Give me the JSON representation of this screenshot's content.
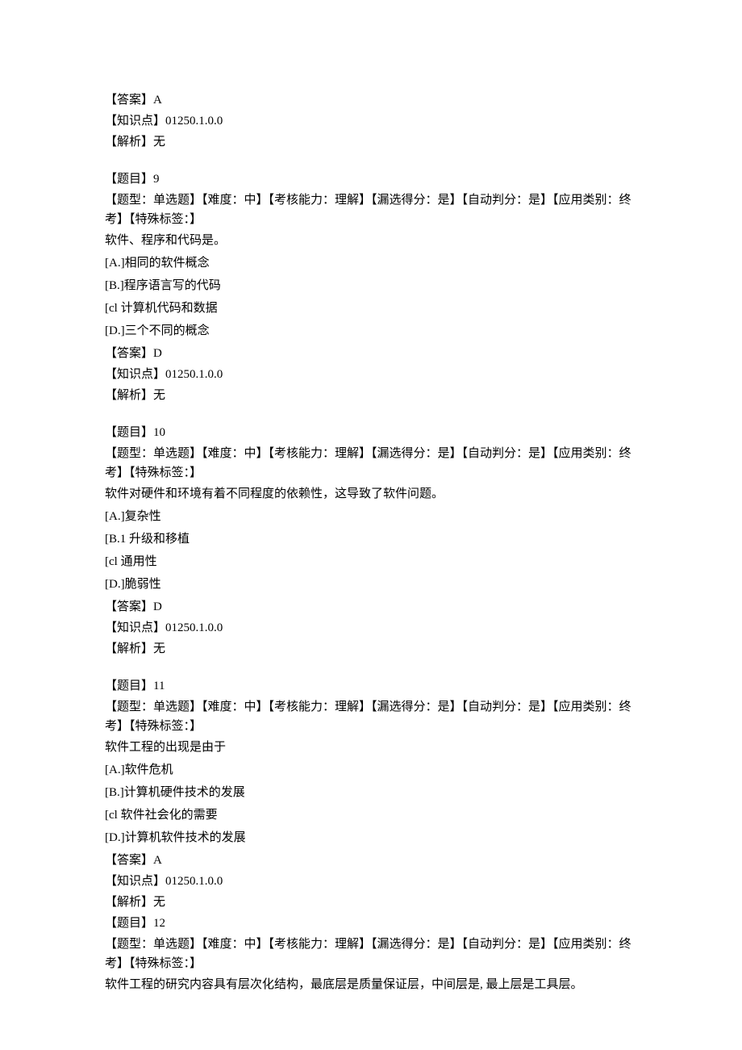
{
  "block0": {
    "answer_label": "【答案】",
    "answer_value": "A",
    "knowledge_label": "【知识点】",
    "knowledge_value": "01250.1.0.0",
    "explain_label": "【解析】",
    "explain_value": "无"
  },
  "q9": {
    "title_label": "【题目】",
    "title_num": "9",
    "meta": "【题型：单选题】【难度：中】【考核能力：理解】【漏选得分：是】【自动判分：是】【应用类别：终考】【特殊标签：】",
    "stem": "软件、程序和代码是。",
    "optA": "[A.]相同的软件概念",
    "optB": "[B.]程序语言写的代码",
    "optC": "[cl 计算机代码和数据",
    "optD": "[D.]三个不同的概念",
    "answer_label": "【答案】",
    "answer_value": "D",
    "knowledge_label": "【知识点】",
    "knowledge_value": "01250.1.0.0",
    "explain_label": "【解析】",
    "explain_value": "无"
  },
  "q10": {
    "title_label": "【题目】",
    "title_num": "10",
    "meta": "【题型：单选题】【难度：中】【考核能力：理解】【漏选得分：是】【自动判分：是】【应用类别：终考】【特殊标签：】",
    "stem": "软件对硬件和环境有着不同程度的依赖性，这导致了软件问题。",
    "optA": "[A.]复杂性",
    "optB": "[B.1 升级和移植",
    "optC": "[cl 通用性",
    "optD": "[D.]脆弱性",
    "answer_label": "【答案】",
    "answer_value": "D",
    "knowledge_label": "【知识点】",
    "knowledge_value": "01250.1.0.0",
    "explain_label": "【解析】",
    "explain_value": "无"
  },
  "q11": {
    "title_label": "【题目】",
    "title_num": "11",
    "meta": "【题型：单选题】【难度：中】【考核能力：理解】【漏选得分：是】【自动判分：是】【应用类别：终考】【特殊标签：】",
    "stem": "软件工程的出现是由于",
    "optA": "[A.]软件危机",
    "optB": "[B.]计算机硬件技术的发展",
    "optC": "[cl 软件社会化的需要",
    "optD": "[D.]计算机软件技术的发展",
    "answer_label": "【答案】",
    "answer_value": "A",
    "knowledge_label": "【知识点】",
    "knowledge_value": "01250.1.0.0",
    "explain_label": "【解析】",
    "explain_value": "无"
  },
  "q12": {
    "title_label": "【题目】",
    "title_num": "12",
    "meta": "【题型：单选题】【难度：中】【考核能力：理解】【漏选得分：是】【自动判分：是】【应用类别：终考】【特殊标签：】",
    "stem": "软件工程的研究内容具有层次化结构，最底层是质量保证层，中间层是, 最上层是工具层。"
  }
}
